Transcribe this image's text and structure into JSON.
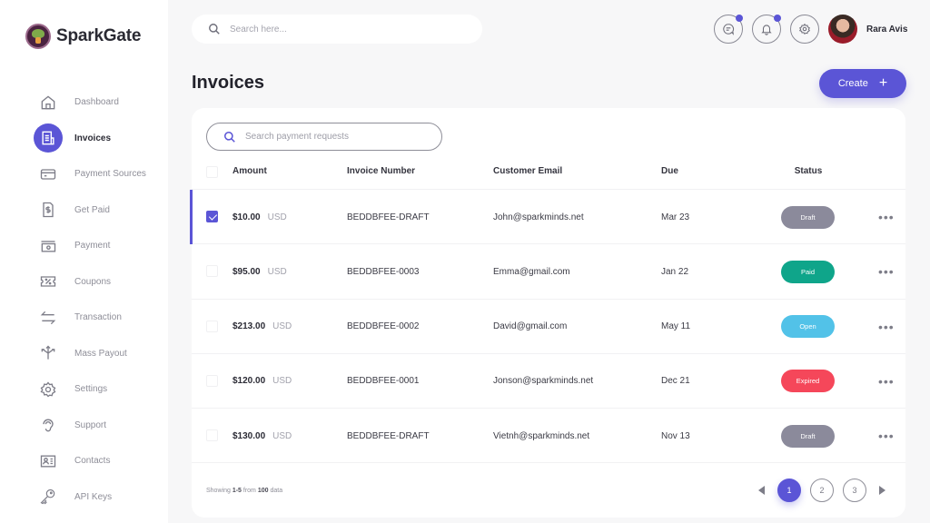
{
  "app": {
    "name": "SparkGate"
  },
  "sidebar": {
    "items": [
      {
        "label": "Dashboard",
        "icon": "home-icon",
        "active": false
      },
      {
        "label": "Invoices",
        "icon": "invoice-icon",
        "active": true
      },
      {
        "label": "Payment Sources",
        "icon": "credit-card-icon",
        "active": false
      },
      {
        "label": "Get Paid",
        "icon": "dollar-document-icon",
        "active": false
      },
      {
        "label": "Payment",
        "icon": "cash-icon",
        "active": false
      },
      {
        "label": "Coupons",
        "icon": "coupon-icon",
        "active": false
      },
      {
        "label": "Transaction",
        "icon": "swap-arrows-icon",
        "active": false
      },
      {
        "label": "Mass Payout",
        "icon": "split-arrows-icon",
        "active": false
      },
      {
        "label": "Settings",
        "icon": "gear-icon",
        "active": false
      },
      {
        "label": "Support",
        "icon": "support-icon",
        "active": false
      },
      {
        "label": "Contacts",
        "icon": "contact-card-icon",
        "active": false
      },
      {
        "label": "API  Keys",
        "icon": "key-icon",
        "active": false
      }
    ]
  },
  "header": {
    "search_placeholder": "Search here...",
    "user_name": "Rara Avis",
    "icons": [
      "chat-icon",
      "bell-icon",
      "gear-icon"
    ]
  },
  "page": {
    "title": "Invoices",
    "create_label": "Create",
    "create_icon": "plus-icon"
  },
  "table": {
    "search_placeholder": "Search payment requests",
    "columns": [
      "Amount",
      "Invoice Number",
      "Customer Email",
      "Due",
      "Status"
    ],
    "rows": [
      {
        "checked": true,
        "amount": "$10.00",
        "currency": "USD",
        "invoice": "BEDDBFEE-DRAFT",
        "email": "John@sparkminds.net",
        "due": "Mar 23",
        "status": "Draft",
        "status_color": "#8b8a9b"
      },
      {
        "checked": false,
        "amount": "$95.00",
        "currency": "USD",
        "invoice": "BEDDBFEE-0003",
        "email": "Emma@gmail.com",
        "due": "Jan 22",
        "status": "Paid",
        "status_color": "#0fa58a"
      },
      {
        "checked": false,
        "amount": "$213.00",
        "currency": "USD",
        "invoice": "BEDDBFEE-0002",
        "email": "David@gmail.com",
        "due": "May 11",
        "status": "Open",
        "status_color": "#52c2e8"
      },
      {
        "checked": false,
        "amount": "$120.00",
        "currency": "USD",
        "invoice": "BEDDBFEE-0001",
        "email": "Jonson@sparkminds.net",
        "due": "Dec 21",
        "status": "Expired",
        "status_color": "#f5475a"
      },
      {
        "checked": false,
        "amount": "$130.00",
        "currency": "USD",
        "invoice": "BEDDBFEE-DRAFT",
        "email": "Vietnh@sparkminds.net",
        "due": "Nov 13",
        "status": "Draft",
        "status_color": "#8b8a9b"
      }
    ],
    "more_label": "•••"
  },
  "footer": {
    "showing_prefix": "Showing",
    "range": "1-5",
    "from_label": "from",
    "total": "100",
    "suffix": "data",
    "pages": [
      "1",
      "2",
      "3"
    ],
    "current_page": "1"
  },
  "colors": {
    "accent": "#5b55d6"
  }
}
